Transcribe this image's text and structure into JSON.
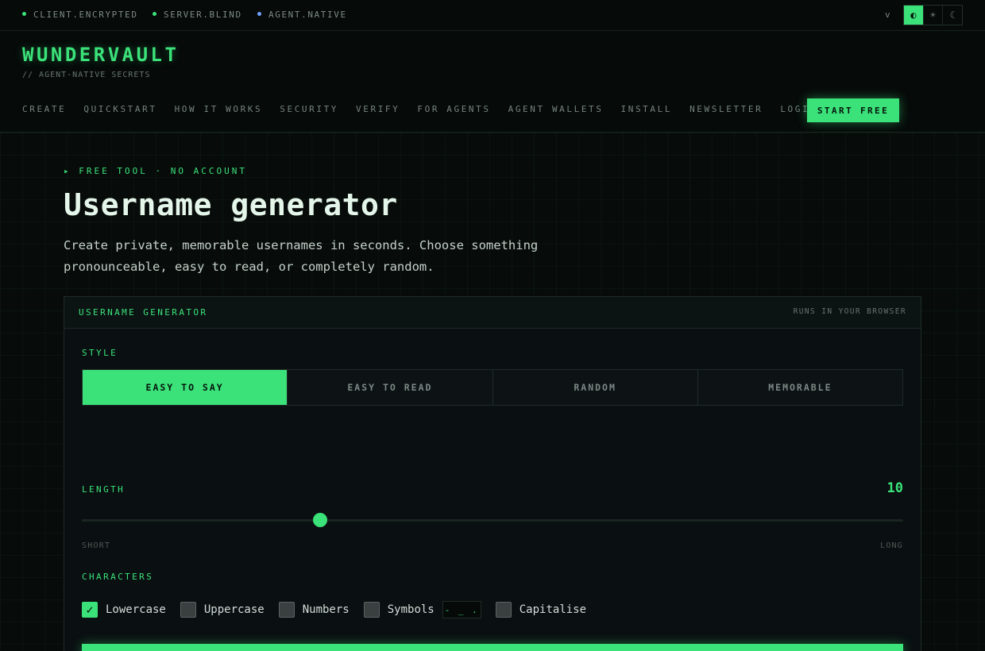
{
  "status_bar": {
    "items": [
      {
        "label": "CLIENT.ENCRYPTED",
        "color": "#3be27a"
      },
      {
        "label": "SERVER.BLIND",
        "color": "#3be27a"
      },
      {
        "label": "AGENT.NATIVE",
        "color": "#6fa0ff"
      }
    ],
    "version": "v",
    "theme_options": [
      {
        "icon": "auto-theme-icon",
        "glyph": "◐",
        "selected": true
      },
      {
        "icon": "sun-icon",
        "glyph": "☀",
        "selected": false
      },
      {
        "icon": "moon-icon",
        "glyph": "☾",
        "selected": false
      }
    ]
  },
  "header": {
    "brand": "WUNDERVAULT",
    "tagline": "// AGENT-NATIVE SECRETS",
    "nav": [
      "CREATE",
      "QUICKSTART",
      "HOW IT WORKS",
      "SECURITY",
      "VERIFY",
      "FOR AGENTS",
      "AGENT WALLETS",
      "INSTALL",
      "NEWSLETTER",
      "LOGIN"
    ],
    "cta": "START FREE"
  },
  "hero": {
    "kicker": "▸ FREE TOOL · NO ACCOUNT",
    "title": "Username generator",
    "lede": "Create private, memorable usernames in seconds. Choose something pronounceable, easy to read, or completely random."
  },
  "tool": {
    "title": "USERNAME GENERATOR",
    "meta": "RUNS IN YOUR BROWSER",
    "style_label": "STYLE",
    "styles": [
      "EASY TO SAY",
      "EASY TO READ",
      "RANDOM",
      "MEMORABLE"
    ],
    "selected_style": "EASY TO SAY",
    "length_label": "LENGTH",
    "length_value": "10",
    "length_fraction": 0.29,
    "range_min_label": "SHORT",
    "range_max_label": "LONG",
    "characters_label": "CHARACTERS",
    "characters": [
      {
        "label": "Lowercase",
        "checked": true
      },
      {
        "label": "Uppercase",
        "checked": false
      },
      {
        "label": "Numbers",
        "checked": false
      },
      {
        "label": "Symbols",
        "checked": false
      },
      {
        "label": "Capitalise",
        "checked": false
      }
    ],
    "symbols_value": "- _ ."
  },
  "colors": {
    "accent": "#3be27a",
    "background": "#070b0a",
    "panel": "#0a0f11"
  }
}
